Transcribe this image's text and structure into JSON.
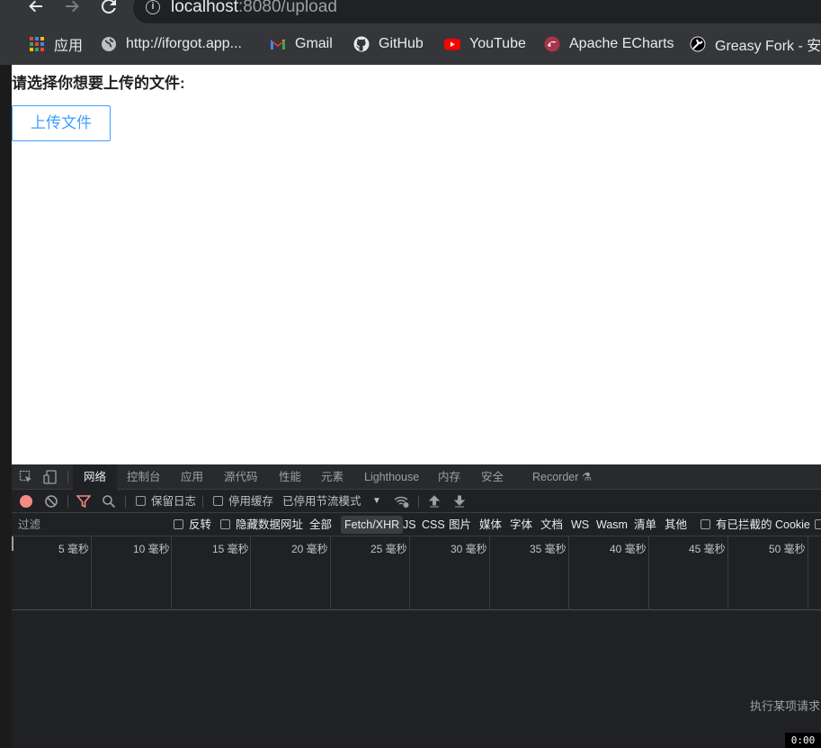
{
  "browser": {
    "url_host": "localhost",
    "url_path": ":8080/upload",
    "bookmarks": [
      {
        "label": "应用",
        "icon": "apps-grid-icon"
      },
      {
        "label": "http://iforgot.app...",
        "icon": "globe-icon"
      },
      {
        "label": "Gmail",
        "icon": "gmail-icon"
      },
      {
        "label": "GitHub",
        "icon": "github-icon"
      },
      {
        "label": "YouTube",
        "icon": "youtube-icon"
      },
      {
        "label": "Apache ECharts",
        "icon": "echarts-icon"
      },
      {
        "label": "Greasy Fork - 安",
        "icon": "greasyfork-icon"
      }
    ]
  },
  "page": {
    "prompt": "请选择你想要上传的文件:",
    "upload_label": "上传文件",
    "accent": "#409eff"
  },
  "devtools": {
    "tabs": [
      "网络",
      "控制台",
      "应用",
      "源代码",
      "性能",
      "元素",
      "Lighthouse",
      "内存",
      "安全",
      "Recorder"
    ],
    "toolbar": {
      "preserve_log": "保留日志",
      "disable_cache": "停用缓存",
      "throttling": "已停用节流模式"
    },
    "filter": {
      "placeholder": "过滤",
      "invert": "反转",
      "hide_data_urls": "隐藏数据网址",
      "types": [
        "全部",
        "Fetch/XHR",
        "JS",
        "CSS",
        "图片",
        "媒体",
        "字体",
        "文档",
        "WS",
        "Wasm",
        "清单",
        "其他"
      ],
      "active_type": "Fetch/XHR",
      "blocked_cookies": "有已拦截的 Cookie"
    },
    "timeline_ticks": [
      "5 毫秒",
      "10 毫秒",
      "15 毫秒",
      "20 毫秒",
      "25 毫秒",
      "30 毫秒",
      "35 毫秒",
      "40 毫秒",
      "45 毫秒",
      "50 毫秒"
    ],
    "hint": "执行某项请求或",
    "record_color": "#f28b82"
  },
  "timer": "0:00"
}
